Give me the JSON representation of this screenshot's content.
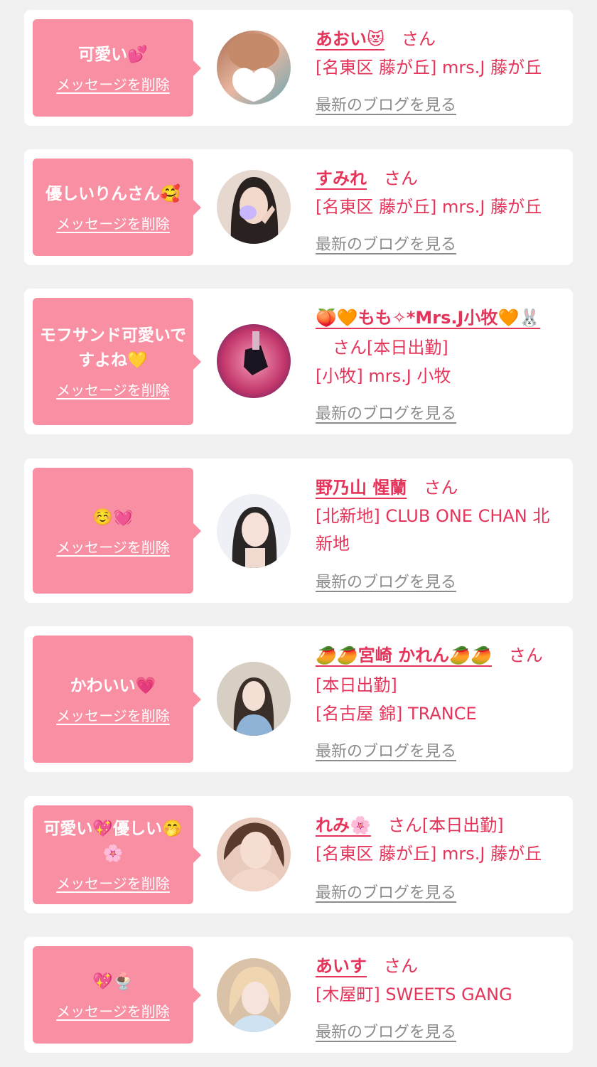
{
  "ui": {
    "delete_label": "メッセージを削除",
    "blog_label": "最新のブログを見る",
    "san_label": "さん"
  },
  "colors": {
    "background": "#f1f1f1",
    "card": "#ffffff",
    "bubble": "#f98fa3",
    "name_text": "#e5345a",
    "blog_link": "#8c8c8c"
  },
  "cards": [
    {
      "message": "可愛い💕",
      "name": "あおい😻",
      "status": "",
      "shop": "[名東区 藤が丘] mrs.J 藤が丘"
    },
    {
      "message": "優しいりんさん🥰",
      "name": "すみれ",
      "status": "",
      "shop": "[名東区 藤が丘] mrs.J 藤が丘"
    },
    {
      "message": "モフサンド可愛いですよね💛",
      "name": "🍑🧡もも✧*Mrs.J小牧🧡🐰",
      "status": "[本日出勤]",
      "shop": "[小牧] mrs.J 小牧"
    },
    {
      "message": "☺️💓",
      "name": "野乃山 惺蘭",
      "status": "",
      "shop": "[北新地] CLUB ONE CHAN 北新地"
    },
    {
      "message": "かわいい💗",
      "name": "🥭🥭宮崎 かれん🥭🥭",
      "status": "[本日出勤]",
      "shop": "[名古屋 錦] TRANCE"
    },
    {
      "message": "可愛い💖優しい🤭🌸",
      "name": "れみ🌸",
      "status": "[本日出勤]",
      "shop": "[名東区 藤が丘] mrs.J 藤が丘"
    },
    {
      "message": "💖🍨",
      "name": "あいす",
      "status": "",
      "shop": "[木屋町] SWEETS GANG"
    }
  ]
}
